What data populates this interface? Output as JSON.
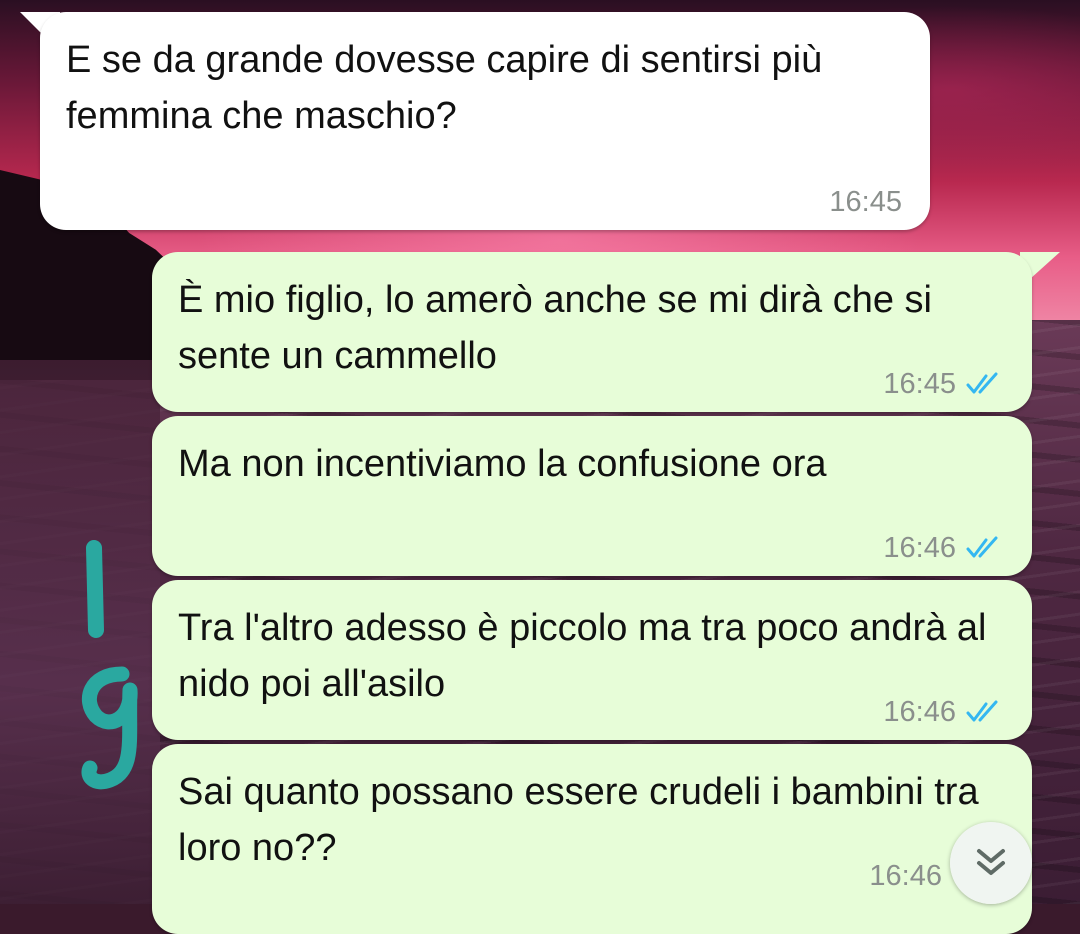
{
  "messages": [
    {
      "direction": "incoming",
      "text": "E se da grande dovesse capire di sentirsi più femmina che maschio?",
      "time": "16:45"
    },
    {
      "direction": "outgoing",
      "text": "È mio figlio, lo amerò anche se mi dirà che si sente un cammello",
      "time": "16:45",
      "status": "read"
    },
    {
      "direction": "outgoing",
      "text": "Ma non incentiviamo la confusione ora",
      "time": "16:46",
      "status": "read"
    },
    {
      "direction": "outgoing",
      "text": "Tra l'altro adesso è piccolo ma tra poco andrà al nido poi all'asilo",
      "time": "16:46",
      "status": "read"
    },
    {
      "direction": "outgoing",
      "text": "Sai quanto possano essere crudeli i bambini tra loro no??",
      "time": "16:46",
      "status": "read"
    }
  ],
  "colors": {
    "incoming_bubble": "#ffffff",
    "outgoing_bubble": "#e7fdd8",
    "read_ticks": "#34b7f1",
    "timestamp": "#8a8f8c",
    "marker": "#2aa8a0"
  },
  "icons": {
    "read_status": "double-check-icon",
    "scroll_down": "double-chevron-down-icon"
  },
  "overlay": {
    "handwritten_marks": "teal marker strokes"
  }
}
